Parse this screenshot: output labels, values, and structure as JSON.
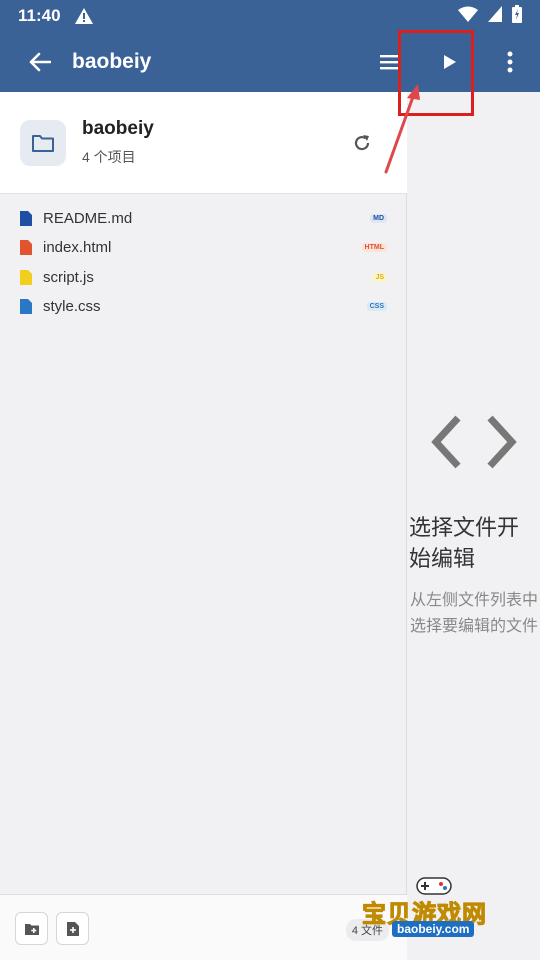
{
  "status": {
    "time": "11:40"
  },
  "appbar": {
    "title": "baobeiy"
  },
  "folder": {
    "name": "baobeiy",
    "count": "4 个项目"
  },
  "files": [
    {
      "name": "README.md",
      "badge": "MD",
      "icon_color": "#1f4fa3",
      "badge_color": "#1f4fa3",
      "badge_bg": "#dde6f5"
    },
    {
      "name": "index.html",
      "badge": "HTML",
      "icon_color": "#e2532f",
      "badge_color": "#e2532f",
      "badge_bg": "#fbe3dc"
    },
    {
      "name": "script.js",
      "badge": "JS",
      "icon_color": "#f2cf1d",
      "badge_color": "#d8b200",
      "badge_bg": "#fbf4cd"
    },
    {
      "name": "style.css",
      "badge": "CSS",
      "icon_color": "#2a78c4",
      "badge_color": "#2a78c4",
      "badge_bg": "#dbe8f6"
    }
  ],
  "bottom": {
    "file_count": "4 文件"
  },
  "editor": {
    "title": "选择文件开始编辑",
    "subtitle": "从左侧文件列表中选择要编辑的文件"
  },
  "watermark": {
    "text": "宝贝游戏网",
    "url": "baobeiy.com"
  },
  "colors": {
    "primary": "#3a6296",
    "annotation": "#d9201f"
  }
}
